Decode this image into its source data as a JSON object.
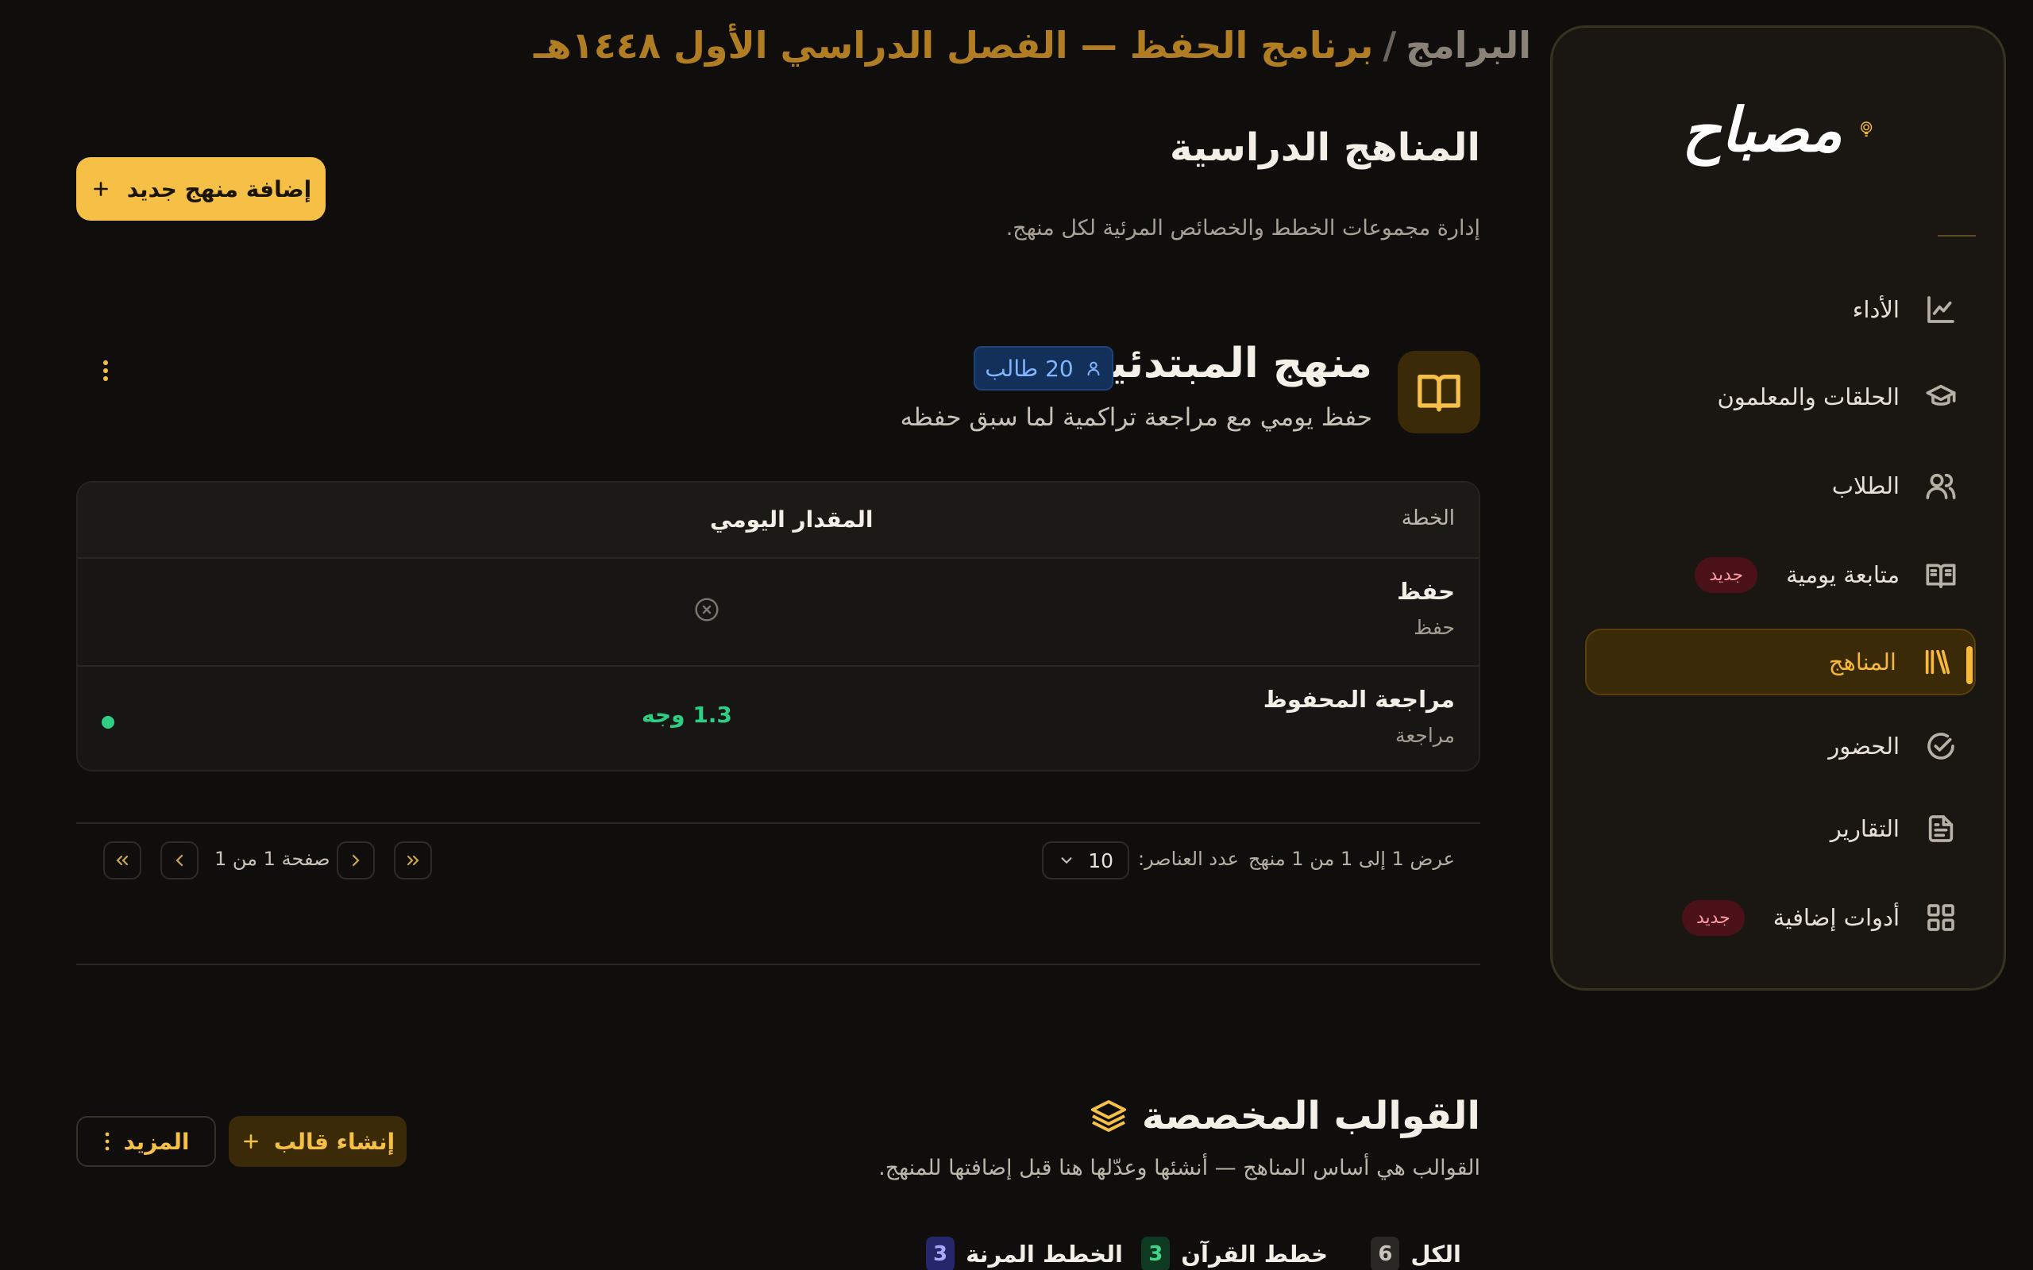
{
  "sidebar": {
    "logo_text": "مصباح",
    "items": [
      {
        "label": "الأداء",
        "icon": "chart-line-icon"
      },
      {
        "label": "الحلقات والمعلمون",
        "icon": "graduation-cap-icon"
      },
      {
        "label": "الطلاب",
        "icon": "users-icon"
      },
      {
        "label": "متابعة يومية",
        "icon": "book-open-icon",
        "badge": "جديد"
      },
      {
        "label": "المناهج",
        "icon": "library-icon",
        "active": true
      },
      {
        "label": "الحضور",
        "icon": "check-circle-icon"
      },
      {
        "label": "التقارير",
        "icon": "file-text-icon"
      },
      {
        "label": "أدوات إضافية",
        "icon": "grid-icon",
        "badge": "جديد"
      }
    ]
  },
  "breadcrumb": {
    "root": "البرامج",
    "separator": "/",
    "current": "برنامج الحفظ — الفصل الدراسي الأول ١٤٤٨هـ"
  },
  "page": {
    "title": "المناهج الدراسية",
    "subtitle": "إدارة مجموعات الخطط والخصائص المرئية لكل منهج.",
    "add_button": "إضافة منهج جديد"
  },
  "curriculum": {
    "title": "منهج المبتدئين",
    "students_badge": "20 طالب",
    "description": "حفظ يومي مع مراجعة تراكمية لما سبق حفظه",
    "table": {
      "columns": [
        "الخطة",
        "المقدار اليومي"
      ],
      "rows": [
        {
          "name": "حفظ",
          "type": "حفظ",
          "amount": ""
        },
        {
          "name": "مراجعة المحفوظ",
          "type": "مراجعة",
          "amount": "1.3 وجه"
        }
      ]
    }
  },
  "pagination": {
    "showing": "عرض 1 إلى 1 من 1 منهج",
    "per_page_label": "عدد العناصر:",
    "per_page_value": "10",
    "page_text": "صفحة 1 من 1"
  },
  "templates": {
    "title": "القوالب المخصصة",
    "description": "القوالب هي أساس المناهج — أنشئها وعدّلها هنا قبل إضافتها للمنهج.",
    "create_button": "إنشاء قالب",
    "more_button": "المزيد",
    "tabs": [
      {
        "label": "الكل",
        "count": "6"
      },
      {
        "label": "خطط القرآن",
        "count": "3"
      },
      {
        "label": "الخطط المرنة",
        "count": "3"
      }
    ]
  },
  "colors": {
    "accent": "#f6c047",
    "active_nav_bg": "#3a2a08",
    "success": "#2ecf84",
    "badge_blue": "#13305a"
  }
}
